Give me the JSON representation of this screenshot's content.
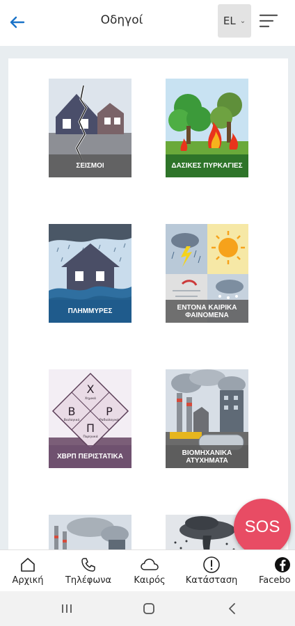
{
  "header": {
    "title": "Οδηγοί",
    "language": "EL"
  },
  "guides": [
    {
      "label": "ΣΕΙΣΜΟΙ",
      "icon": "earthquake-icon"
    },
    {
      "label": "ΔΑΣΙΚΕΣ ΠΥΡΚΑΓΙΕΣ",
      "icon": "forest-fire-icon"
    },
    {
      "label": "ΠΛΗΜΜΥΡΕΣ",
      "icon": "flood-icon"
    },
    {
      "label": "ΕΝΤΟΝΑ ΚΑΙΡΙΚΑ ΦΑΙΝΟΜΕΝΑ",
      "icon": "severe-weather-icon"
    },
    {
      "label": "ΧΒΡΠ ΠΕΡΙΣΤΑΤΙΚΑ",
      "icon": "cbrn-icon"
    },
    {
      "label": "ΒΙΟΜΗΧΑΝΙΚΑ ΑΤΥΧΗΜΑΤΑ",
      "icon": "industrial-accident-icon"
    }
  ],
  "cbrn_diagram": {
    "top": "Χ",
    "left": "Β",
    "right": "Ρ",
    "bottom": "Π",
    "top_sub": "Χημικά",
    "left_sub": "Βιολογικά",
    "right_sub": "Ραδιολογικά",
    "bottom_sub": "Πυρηνικά"
  },
  "sos_label": "SOS",
  "bottom_nav": [
    {
      "label": "Αρχική",
      "icon": "home-icon"
    },
    {
      "label": "Τηλέφωνα",
      "icon": "phone-icon"
    },
    {
      "label": "Καιρός",
      "icon": "cloud-icon"
    },
    {
      "label": "Κατάσταση",
      "icon": "alert-icon"
    },
    {
      "label": "Facebo",
      "icon": "facebook-icon"
    }
  ],
  "colors": {
    "accent": "#1a73c8",
    "sos": "#e84c64",
    "background": "#e8edf0"
  }
}
